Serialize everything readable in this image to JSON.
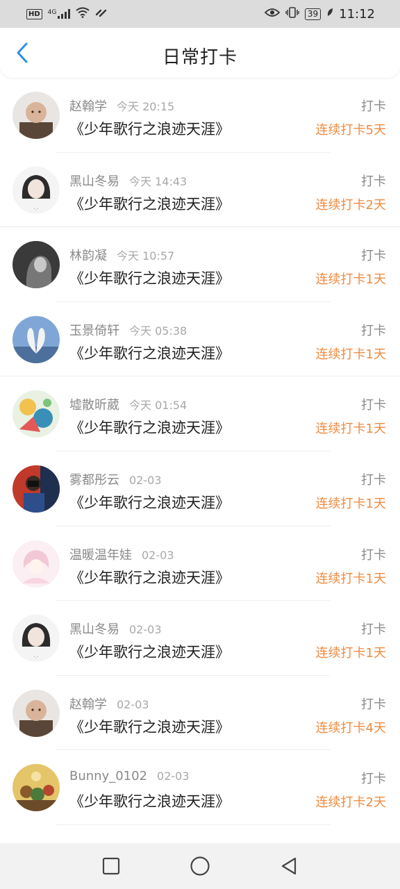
{
  "status_bar": {
    "left_text": "HD",
    "network": "4G",
    "battery": "39",
    "time": "11:12"
  },
  "header": {
    "title": "日常打卡",
    "back_icon": "chevron-left-icon",
    "accent_color": "#2e8fe8"
  },
  "colors": {
    "streak": "#f08a3e",
    "meta": "#8a8a8a"
  },
  "feed": [
    {
      "user": "赵翰学",
      "time": "今天 20:15",
      "book": "《少年歌行之浪迹天涯》",
      "action": "打卡",
      "streak": "连续打卡5天",
      "avatar": "baby-photo"
    },
    {
      "user": "黑山冬易",
      "time": "今天 14:43",
      "book": "《少年歌行之浪迹天涯》",
      "action": "打卡",
      "streak": "连续打卡2天",
      "avatar": "girl-sketch"
    },
    {
      "user": "林韵凝",
      "time": "今天 10:57",
      "book": "《少年歌行之浪迹天涯》",
      "action": "打卡",
      "streak": "连续打卡1天",
      "avatar": "bw-portrait"
    },
    {
      "user": "玉景倚轩",
      "time": "今天 05:38",
      "book": "《少年歌行之浪迹天涯》",
      "action": "打卡",
      "streak": "连续打卡1天",
      "avatar": "swans-heart"
    },
    {
      "user": "墟散昕葳",
      "time": "今天 01:54",
      "book": "《少年歌行之浪迹天涯》",
      "action": "打卡",
      "streak": "连续打卡1天",
      "avatar": "anime-art"
    },
    {
      "user": "雾都彤云",
      "time": "02-03",
      "book": "《少年歌行之浪迹天涯》",
      "action": "打卡",
      "streak": "连续打卡1天",
      "avatar": "camera-boy"
    },
    {
      "user": "温暖温年娃",
      "time": "02-03",
      "book": "《少年歌行之浪迹天涯》",
      "action": "打卡",
      "streak": "连续打卡1天",
      "avatar": "pink-anime-girl"
    },
    {
      "user": "黑山冬易",
      "time": "02-03",
      "book": "《少年歌行之浪迹天涯》",
      "action": "打卡",
      "streak": "连续打卡1天",
      "avatar": "girl-sketch"
    },
    {
      "user": "赵翰学",
      "time": "02-03",
      "book": "《少年歌行之浪迹天涯》",
      "action": "打卡",
      "streak": "连续打卡4天",
      "avatar": "baby-photo"
    },
    {
      "user": "Bunny_0102",
      "time": "02-03",
      "book": "《少年歌行之浪迹天涯》",
      "action": "打卡",
      "streak": "连续打卡2天",
      "avatar": "cartoon-crowd"
    }
  ],
  "nav_bar": {
    "recents_icon": "square-icon",
    "home_icon": "circle-icon",
    "back_icon": "triangle-back-icon"
  }
}
